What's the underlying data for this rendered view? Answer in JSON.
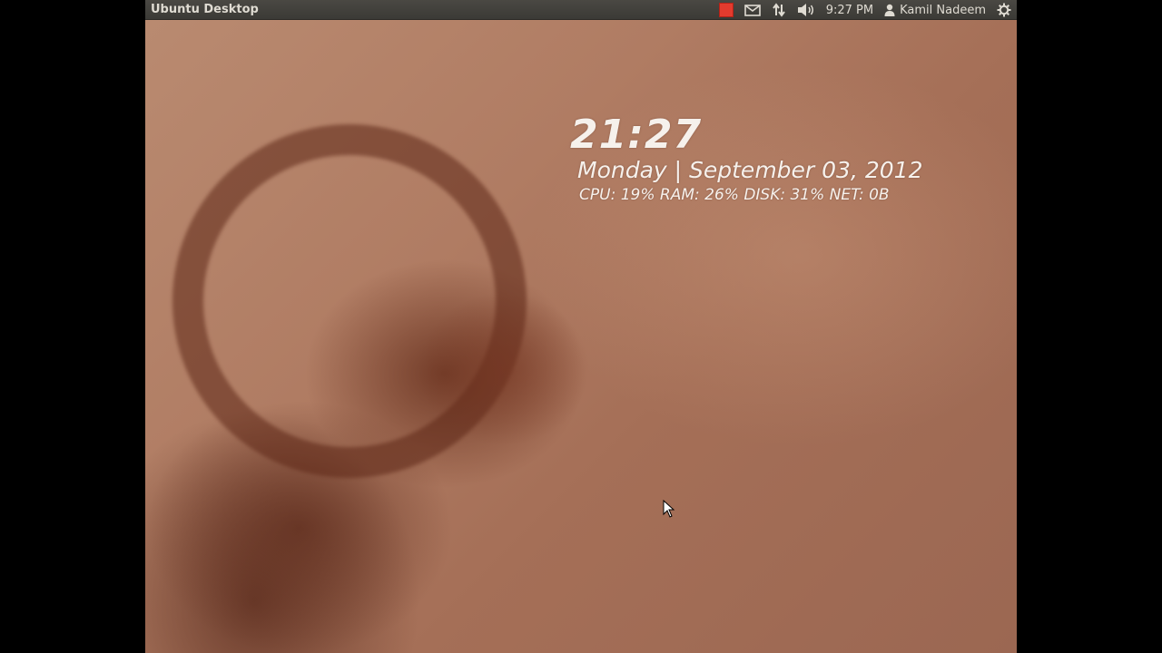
{
  "panel": {
    "title": "Ubuntu Desktop",
    "indicators": {
      "red_indicator_color": "#e33b2e",
      "mail_icon": "mail-icon",
      "network_icon": "network-icon",
      "volume_icon": "volume-icon",
      "clock": "9:27 PM",
      "user_icon": "user-icon",
      "user_name": "Kamil Nadeem",
      "session_icon": "gear-icon"
    }
  },
  "conky": {
    "time": "21:27",
    "date": "Monday | September 03, 2012",
    "stats": "CPU: 19% RAM: 26% DISK: 31% NET: 0B"
  }
}
